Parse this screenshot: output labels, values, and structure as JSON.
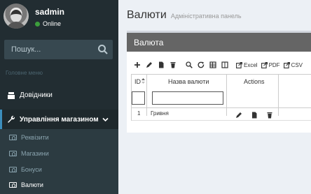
{
  "user": {
    "name": "sadmin",
    "status": "Online"
  },
  "search": {
    "placeholder": "Пошук..."
  },
  "sidebar": {
    "section_header": "Головне меню",
    "items": [
      {
        "label": "Довідники",
        "icon": "book-icon"
      },
      {
        "label": "Управління магазином",
        "icon": "wrench-icon"
      }
    ],
    "subitems": [
      {
        "label": "Реквізити",
        "icon": "money-icon"
      },
      {
        "label": "Магазини",
        "icon": "money-icon"
      },
      {
        "label": "Бонуси",
        "icon": "money-icon"
      },
      {
        "label": "Валюти",
        "icon": "money-icon"
      }
    ]
  },
  "header": {
    "title": "Валюти",
    "subtitle": "Адміністративна панель"
  },
  "box": {
    "title": "Валюта"
  },
  "toolbar": {
    "excel_label": "Excel",
    "pdf_label": "PDF",
    "csv_label": "CSV"
  },
  "table": {
    "columns": [
      "ID",
      "Назва валюти",
      "Actions"
    ],
    "rows": [
      {
        "id": "1",
        "name": "Гривня"
      }
    ]
  },
  "colors": {
    "sidebar_bg": "#222d32",
    "accent": "#3c8dbc",
    "box_header_bg": "#656565"
  }
}
